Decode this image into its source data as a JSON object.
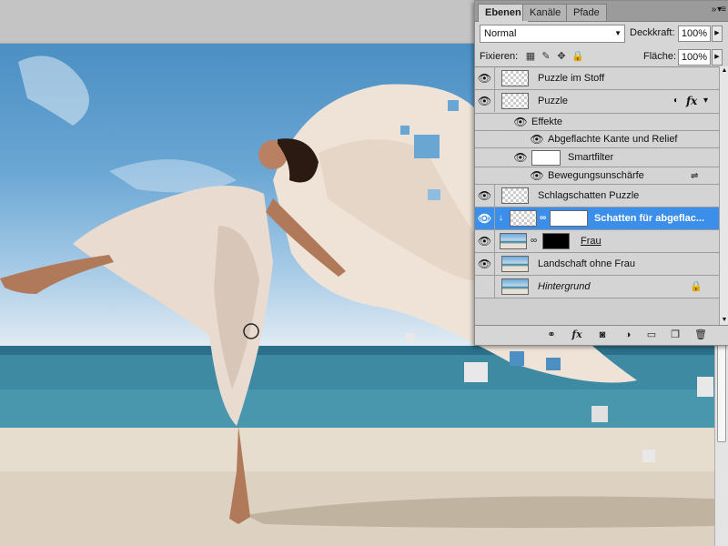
{
  "panel": {
    "tabs": [
      "Ebenen",
      "Kanäle",
      "Pfade"
    ],
    "menu_icon": "»  ▾≡",
    "blend_mode": "Normal",
    "opacity_label": "Deckkraft:",
    "opacity_value": "100%",
    "lock_label": "Fixieren:",
    "fill_label": "Fläche:",
    "fill_value": "100%"
  },
  "layers": [
    {
      "name": "Puzzle im Stoff",
      "visible": true,
      "thumb": "transparent"
    },
    {
      "name": "Puzzle",
      "visible": true,
      "thumb": "smart-object",
      "fx": "fx"
    },
    {
      "name": "Effekte",
      "visible": true,
      "sub": 1
    },
    {
      "name": "Abgeflachte Kante und Relief",
      "visible": true,
      "sub": 2
    },
    {
      "name": "Smartfilter",
      "visible": true,
      "sub": 1,
      "thumb": "white"
    },
    {
      "name": "Bewegungsunschärfe",
      "visible": true,
      "sub": 2
    },
    {
      "name": "Schlagschatten Puzzle",
      "visible": true,
      "thumb": "transparent"
    },
    {
      "name": "Schatten für abgeflac...",
      "visible": true,
      "selected": true,
      "thumb": "smart-object",
      "mask": "white"
    },
    {
      "name": "Frau",
      "visible": true,
      "thumb": "beach",
      "mask": "black"
    },
    {
      "name": "Landschaft ohne Frau",
      "visible": true,
      "thumb": "beach"
    },
    {
      "name": "Hintergrund",
      "visible": false,
      "thumb": "beach",
      "locked": true
    }
  ],
  "bottom_icons": [
    "link-icon",
    "fx-icon",
    "mask-icon",
    "adjustment-icon",
    "folder-icon",
    "new-layer-icon",
    "trash-icon"
  ],
  "colors": {
    "selection": "#3b8ee9",
    "panel_bg": "#d6d6d6"
  }
}
